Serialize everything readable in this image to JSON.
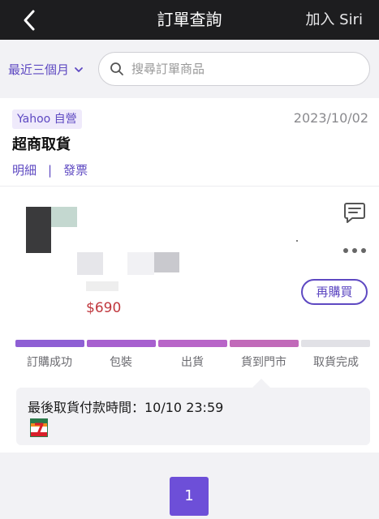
{
  "header": {
    "title": "訂單查詢",
    "siri_label": "加入 Siri"
  },
  "filter": {
    "range_label": "最近三個月",
    "search_placeholder": "搜尋訂單商品"
  },
  "order": {
    "store_badge": "Yahoo 自營",
    "date": "2023/10/02",
    "delivery_method": "超商取貨",
    "detail_link": "明細",
    "separator": "|",
    "invoice_link": "發票",
    "price": "$690",
    "rebuy_label": "再購買",
    "steps": [
      {
        "label": "訂購成功",
        "done": true
      },
      {
        "label": "包裝",
        "done": true
      },
      {
        "label": "出貨",
        "done": true
      },
      {
        "label": "貨到門市",
        "done": true
      },
      {
        "label": "取貨完成",
        "done": false
      }
    ],
    "progress_colors": [
      "#8e5fd4",
      "#a760cf",
      "#b865c8",
      "#c16ab9",
      "#e1e1e6"
    ],
    "notice_text": "最後取貨付款時間：10/10 23:59"
  },
  "pagination": {
    "current_page": "1"
  },
  "colors": {
    "accent": "#5e49c2",
    "price": "#c0383e",
    "header_bg": "#1d1d1f",
    "page_button": "#6d4fd8"
  },
  "icons": {
    "back": "chevron-left-icon",
    "dropdown": "chevron-down-icon",
    "search": "search-icon",
    "chat": "chat-icon",
    "more": "more-icon",
    "store_logo": "seven-eleven-logo"
  }
}
